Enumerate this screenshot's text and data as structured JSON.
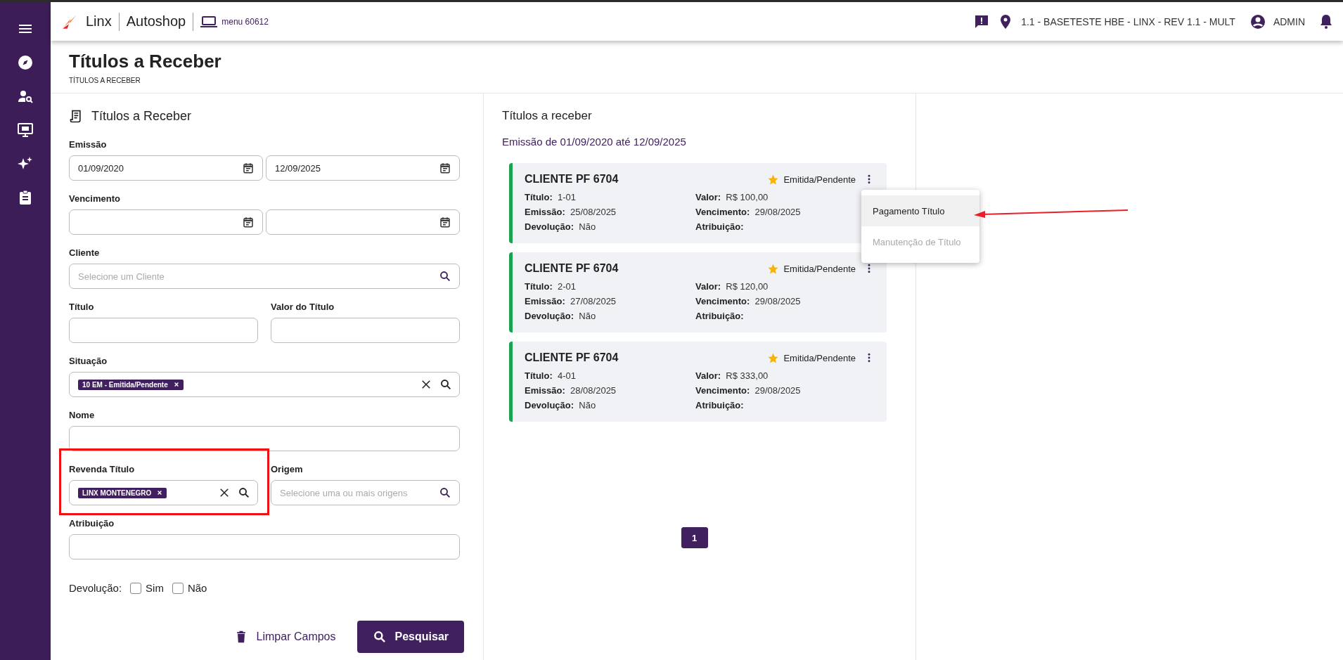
{
  "header": {
    "brand": "Linx",
    "product": "Autoshop",
    "menu": "menu 60612",
    "location": "1.1 - BASETESTE HBE - LINX - REV 1.1 - MULT",
    "user": "ADMIN"
  },
  "page": {
    "title": "Títulos a Receber",
    "breadcrumb": "TÍTULOS A RECEBER"
  },
  "form": {
    "title": "Títulos a Receber",
    "rows": [
      {
        "label": "Emissão",
        "items": [
          {
            "kind": "date",
            "value": "01/09/2020"
          },
          {
            "kind": "date",
            "value": "12/09/2025"
          }
        ]
      },
      {
        "label": "Vencimento",
        "items": [
          {
            "kind": "date"
          },
          {
            "kind": "date"
          }
        ]
      },
      {
        "label": "Cliente",
        "items": [
          {
            "kind": "search",
            "placeholder": "Selecione um Cliente"
          }
        ]
      },
      {
        "items": [
          {
            "kind": "text",
            "label": "Título"
          },
          {
            "kind": "text",
            "label": "Valor do Título"
          }
        ]
      },
      {
        "label": "Situação",
        "items": [
          {
            "kind": "chips",
            "chips": [
              "10 EM - Emitida/Pendente"
            ]
          }
        ]
      },
      {
        "label": "Nome",
        "items": [
          {
            "kind": "text"
          }
        ]
      },
      {
        "items": [
          {
            "kind": "chips",
            "label": "Revenda Título",
            "chips": [
              "LINX MONTENEGRO"
            ],
            "annotated": true
          },
          {
            "kind": "search",
            "label": "Origem",
            "placeholder": "Selecione uma ou mais origens"
          }
        ]
      },
      {
        "label": "Atribuição",
        "items": [
          {
            "kind": "text"
          }
        ]
      }
    ],
    "devolucao": {
      "label": "Devolução:",
      "options": [
        {
          "label": "Sim",
          "checked": false
        },
        {
          "label": "Não",
          "checked": false
        }
      ]
    },
    "clear_button": "Limpar Campos",
    "search_button": "Pesquisar"
  },
  "results": {
    "title": "Títulos a receber",
    "subtitle": "Emissão de 01/09/2020 até 12/09/2025",
    "cards": [
      {
        "client": "CLIENTE PF 6704",
        "status": "Emitida/Pendente",
        "fields": [
          {
            "label": "Título:",
            "value": "1-01"
          },
          {
            "label": "Valor:",
            "value": "R$ 100,00"
          },
          {
            "label": "Emissão:",
            "value": "25/08/2025"
          },
          {
            "label": "Vencimento:",
            "value": "29/08/2025"
          },
          {
            "label": "Devolução:",
            "value": "Não"
          },
          {
            "label": "Atribuição:"
          }
        ],
        "menu": [
          {
            "label": "Pagamento Título",
            "disabled": false,
            "selected": true,
            "annotated": true
          },
          {
            "label": "Manutenção de Título",
            "disabled": true,
            "selected": false,
            "annotated": false
          }
        ]
      },
      {
        "client": "CLIENTE PF 6704",
        "status": "Emitida/Pendente",
        "fields": [
          {
            "label": "Título:",
            "value": "2-01"
          },
          {
            "label": "Valor:",
            "value": "R$ 120,00"
          },
          {
            "label": "Emissão:",
            "value": "27/08/2025"
          },
          {
            "label": "Vencimento:",
            "value": "29/08/2025"
          },
          {
            "label": "Devolução:",
            "value": "Não"
          },
          {
            "label": "Atribuição:"
          }
        ]
      },
      {
        "client": "CLIENTE PF 6704",
        "status": "Emitida/Pendente",
        "fields": [
          {
            "label": "Título:",
            "value": "4-01"
          },
          {
            "label": "Valor:",
            "value": "R$ 333,00"
          },
          {
            "label": "Emissão:",
            "value": "28/08/2025"
          },
          {
            "label": "Vencimento:",
            "value": "29/08/2025"
          },
          {
            "label": "Devolução:",
            "value": "Não"
          },
          {
            "label": "Atribuição:"
          }
        ]
      }
    ],
    "pages": [
      {
        "label": "1",
        "selected": true
      }
    ]
  }
}
